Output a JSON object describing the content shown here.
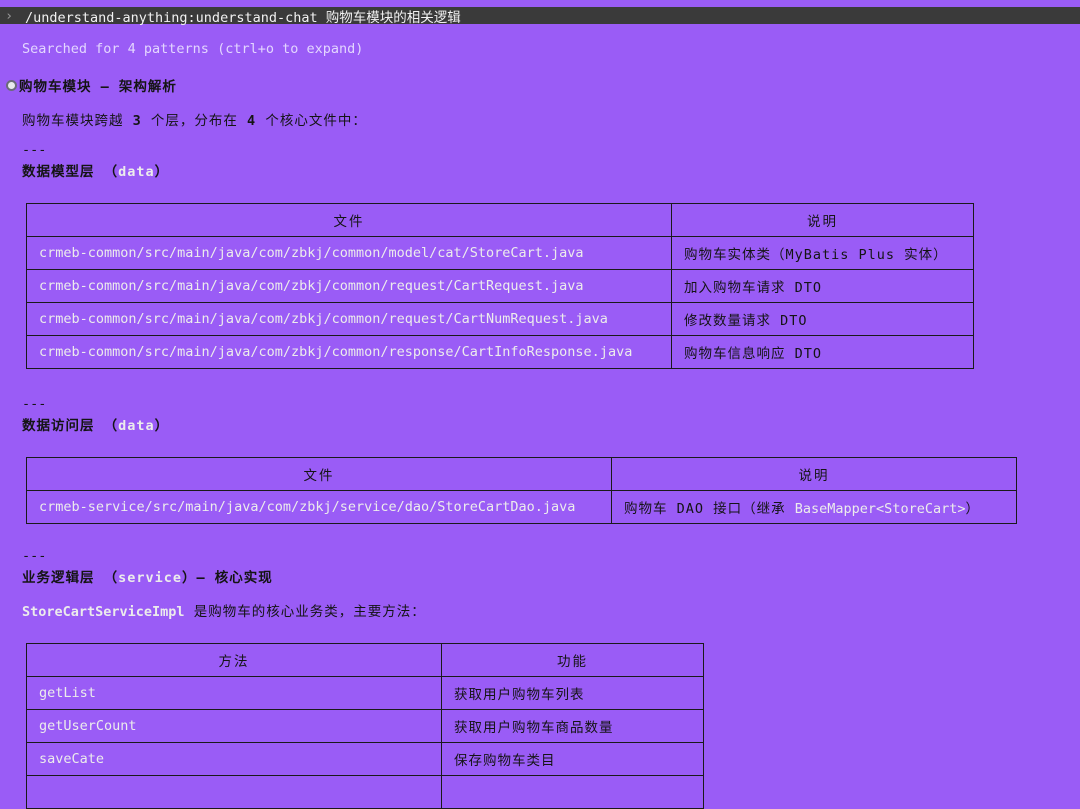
{
  "command": "/understand-anything:understand-chat 购物车模块的相关逻辑",
  "searched": "Searched for 4 patterns (ctrl+o to expand)",
  "title": "购物车模块 — 架构解析",
  "intro": {
    "pre": "购物车模块跨越 ",
    "n1": "3",
    "mid": " 个层，分布在 ",
    "n2": "4",
    "post": " 个核心文件中："
  },
  "separator": "---",
  "data_layer": {
    "title_prefix": "数据模型层 （",
    "title_code": "data",
    "title_suffix": "）",
    "headers": [
      "文件",
      "说明"
    ],
    "rows": [
      {
        "file": "crmeb-common/src/main/java/com/zbkj/common/model/cat/StoreCart.java",
        "desc": "购物车实体类（MyBatis Plus 实体）"
      },
      {
        "file": "crmeb-common/src/main/java/com/zbkj/common/request/CartRequest.java",
        "desc": "加入购物车请求 DTO"
      },
      {
        "file": "crmeb-common/src/main/java/com/zbkj/common/request/CartNumRequest.java",
        "desc": "修改数量请求 DTO"
      },
      {
        "file": "crmeb-common/src/main/java/com/zbkj/common/response/CartInfoResponse.java",
        "desc": "购物车信息响应 DTO"
      }
    ]
  },
  "dao_layer": {
    "title_prefix": "数据访问层 （",
    "title_code": "data",
    "title_suffix": "）",
    "headers": [
      "文件",
      "说明"
    ],
    "rows": [
      {
        "file": "crmeb-service/src/main/java/com/zbkj/service/dao/StoreCartDao.java",
        "desc_pre": "购物车 DAO 接口（继承 ",
        "desc_code": "BaseMapper<StoreCart>",
        "desc_post": "）"
      }
    ]
  },
  "service_layer": {
    "title_prefix": "业务逻辑层 （",
    "title_code": "service",
    "title_suffix": "）— 核心实现",
    "impl_class": "StoreCartServiceImpl",
    "impl_desc": " 是购物车的核心业务类，主要方法：",
    "headers": [
      "方法",
      "功能"
    ],
    "rows": [
      {
        "method": "getList",
        "desc": "获取用户购物车列表"
      },
      {
        "method": "getUserCount",
        "desc": "获取用户购物车商品数量"
      },
      {
        "method": "saveCate",
        "desc": "保存购物车类目"
      }
    ]
  }
}
